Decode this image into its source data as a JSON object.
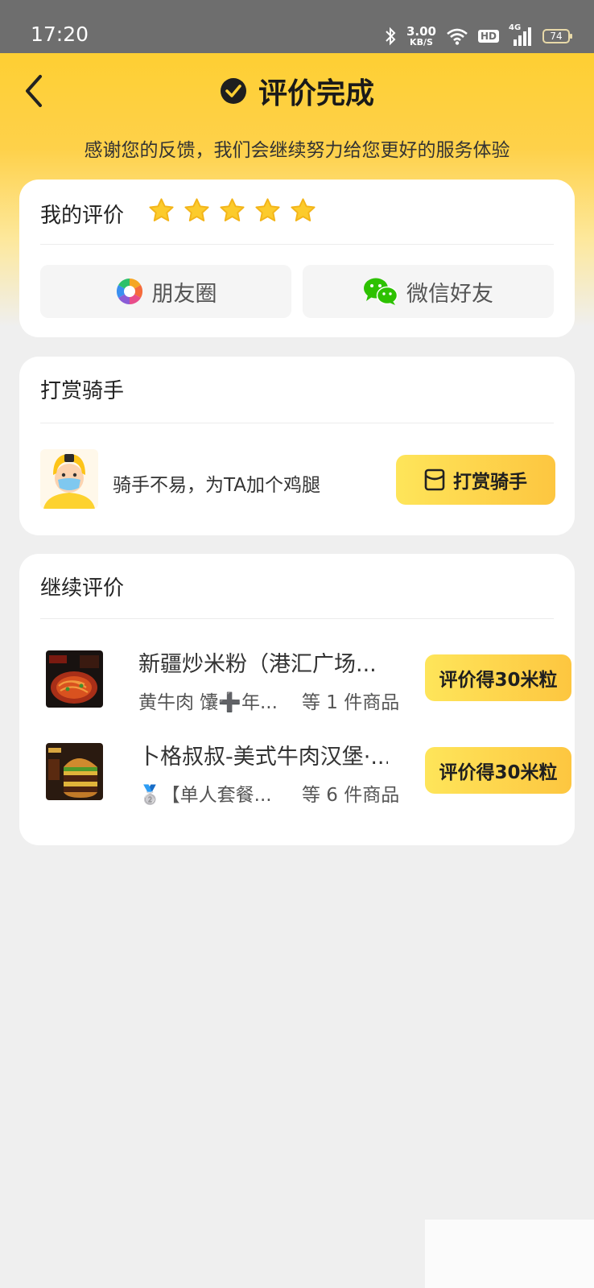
{
  "status_bar": {
    "time": "17:20",
    "speed_value": "3.00",
    "speed_unit": "KB/S",
    "network": "4G",
    "hd": "HD",
    "battery": "74"
  },
  "header": {
    "title": "评价完成",
    "subtitle": "感谢您的反馈，我们会继续努力给您更好的服务体验"
  },
  "rating_card": {
    "label": "我的评价",
    "stars": 5,
    "share_buttons": [
      {
        "label": "朋友圈",
        "icon": "moments-icon"
      },
      {
        "label": "微信好友",
        "icon": "wechat-icon"
      }
    ]
  },
  "tip_card": {
    "title": "打赏骑手",
    "message": "骑手不易，为TA加个鸡腿",
    "button": "打赏骑手"
  },
  "more_reviews": {
    "title": "继续评价",
    "orders": [
      {
        "name": "新疆炒米粉（港汇广场...",
        "items": "黄牛肉 馕➕年...",
        "count": "等 1 件商品",
        "button": "评价得30米粒"
      },
      {
        "name": "卜格叔叔-美式牛肉汉堡·...",
        "items": "🥈【单人套餐...",
        "count": "等 6 件商品",
        "button": "评价得30米粒"
      }
    ]
  },
  "colors": {
    "brand_yellow": "#fecf33",
    "button_gradient_start": "#fee55a",
    "button_gradient_end": "#fdc640",
    "star": "#fccb2c",
    "wechat_green": "#2dc100"
  }
}
